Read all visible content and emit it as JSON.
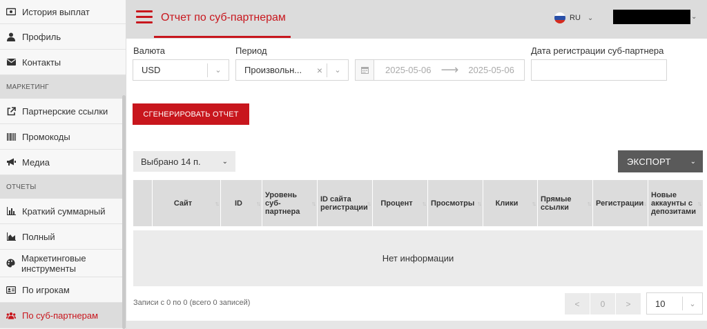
{
  "sidebar": {
    "items_top": [
      {
        "label": "История выплат",
        "icon": "payout-history-icon"
      },
      {
        "label": "Профиль",
        "icon": "user-icon"
      },
      {
        "label": "Контакты",
        "icon": "envelope-icon"
      }
    ],
    "section_marketing": "МАРКЕТИНГ",
    "items_marketing": [
      {
        "label": "Партнерские ссылки",
        "icon": "external-link-icon"
      },
      {
        "label": "Промокоды",
        "icon": "barcode-icon"
      },
      {
        "label": "Медиа",
        "icon": "megaphone-icon"
      }
    ],
    "section_reports": "ОТЧЕТЫ",
    "items_reports": [
      {
        "label": "Краткий суммарный",
        "icon": "bar-chart-icon"
      },
      {
        "label": "Полный",
        "icon": "area-chart-icon"
      },
      {
        "label": "Маркетинговые инструменты",
        "icon": "palette-icon"
      },
      {
        "label": "По игрокам",
        "icon": "id-card-icon"
      },
      {
        "label": "По суб-партнерам",
        "icon": "users-icon",
        "active": true
      }
    ]
  },
  "header": {
    "title": "Отчет по суб-партнерам",
    "lang_code": "RU"
  },
  "filters": {
    "currency_label": "Валюта",
    "currency_value": "USD",
    "period_label": "Период",
    "period_value": "Произвольн...",
    "date_from": "2025-05-06",
    "date_to": "2025-05-06",
    "reg_date_label": "Дата регистрации суб-партнера",
    "reg_date_value": ""
  },
  "actions": {
    "generate_label": "СГЕНЕРИРОВАТЬ ОТЧЕТ",
    "columns_selected": "Выбрано 14 п.",
    "export_label": "ЭКСПОРТ"
  },
  "table": {
    "columns": [
      "",
      "Сайт",
      "ID",
      "Уровень суб-партнера",
      "ID сайта регистрации",
      "Процент",
      "Просмотры",
      "Клики",
      "Прямые ссылки",
      "Регистрации",
      "Новые аккаунты с депозитами"
    ],
    "empty_text": "Нет информации"
  },
  "footer": {
    "records_info": "Записи с 0 по 0 (всего 0 записей)",
    "page_prev": "<",
    "page_current": "0",
    "page_next": ">",
    "page_size": "10"
  },
  "colors": {
    "accent": "#c8161d",
    "export_bg": "#5a5a5a",
    "header_bg": "#dcdcdc"
  }
}
